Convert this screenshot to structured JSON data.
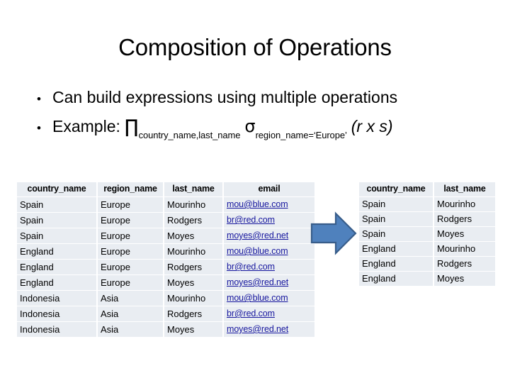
{
  "slide": {
    "title": "Composition of Operations"
  },
  "bullets": [
    {
      "marker": "•",
      "text": "Can build expressions using multiple operations"
    },
    {
      "marker": "•",
      "label": "Example:",
      "formula": {
        "project_symbol": "∏",
        "project_subscript": "country_name,last_name",
        "select_symbol": "σ",
        "select_subscript": "region_name=‘Europe’",
        "operand": "(r x s)"
      }
    }
  ],
  "left_table": {
    "name": "cross-product-result-table",
    "headers": [
      "country_name",
      "region_name",
      "last_name",
      "email"
    ],
    "rows": [
      [
        "Spain",
        "Europe",
        "Mourinho",
        "mou@blue.com"
      ],
      [
        "Spain",
        "Europe",
        "Rodgers",
        "br@red.com"
      ],
      [
        "Spain",
        "Europe",
        "Moyes",
        "moyes@red.net"
      ],
      [
        "England",
        "Europe",
        "Mourinho",
        "mou@blue.com"
      ],
      [
        "England",
        "Europe",
        "Rodgers",
        "br@red.com"
      ],
      [
        "England",
        "Europe",
        "Moyes",
        "moyes@red.net"
      ],
      [
        "Indonesia",
        "Asia",
        "Mourinho",
        "mou@blue.com"
      ],
      [
        "Indonesia",
        "Asia",
        "Rodgers",
        "br@red.com"
      ],
      [
        "Indonesia",
        "Asia",
        "Moyes",
        "moyes@red.net"
      ]
    ]
  },
  "right_table": {
    "name": "projection-result-table",
    "headers": [
      "country_name",
      "last_name"
    ],
    "rows": [
      [
        "Spain",
        "Mourinho"
      ],
      [
        "Spain",
        "Rodgers"
      ],
      [
        "Spain",
        "Moyes"
      ],
      [
        "England",
        "Mourinho"
      ],
      [
        "England",
        "Rodgers"
      ],
      [
        "England",
        "Moyes"
      ]
    ]
  },
  "arrow": {
    "icon": "right-arrow-icon",
    "fill": "#4f81bd",
    "stroke": "#385d8a"
  },
  "colors": {
    "table_cell_bg": "#e9edf2",
    "link": "#17179e",
    "text": "#000000",
    "background": "#ffffff"
  }
}
